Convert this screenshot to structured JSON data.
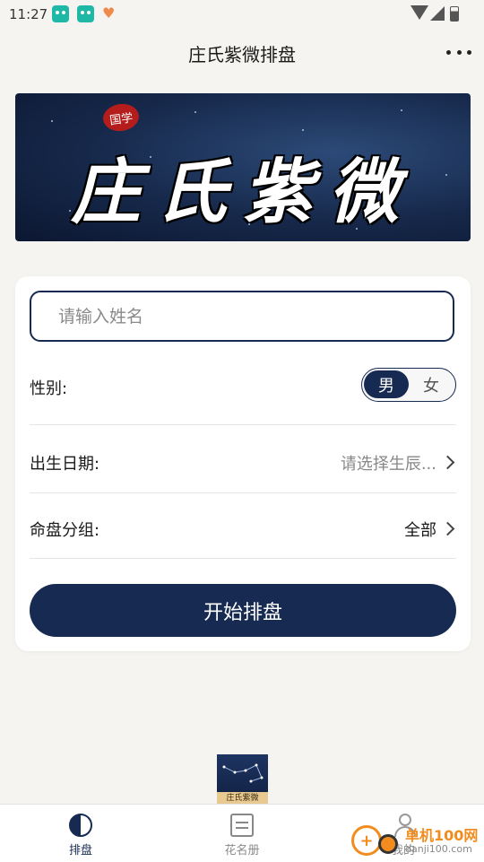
{
  "status": {
    "time": "11:27"
  },
  "header": {
    "title": "庄氏紫微排盘"
  },
  "banner": {
    "seal": "国学",
    "title": "庄氏紫微"
  },
  "form": {
    "name_placeholder": "请输入姓名",
    "gender_label": "性别:",
    "gender_options": [
      "男",
      "女"
    ],
    "gender_selected": "男",
    "birth_label": "出生日期:",
    "birth_value": "请选择生辰...",
    "group_label": "命盘分组:",
    "group_value": "全部",
    "start_label": "开始排盘"
  },
  "thumbnail": {
    "label": "庄氏紫微"
  },
  "tabbar": {
    "items": [
      {
        "label": "排盘",
        "icon": "yinyang-icon",
        "active": true
      },
      {
        "label": "花名册",
        "icon": "document-icon",
        "active": false
      },
      {
        "label": "我的",
        "icon": "user-icon",
        "active": false
      }
    ]
  },
  "watermark": {
    "name": "单机100网",
    "url": "danji100.com"
  },
  "colors": {
    "primary": "#162a52",
    "background": "#f5f4f0",
    "watermark": "#f28c1e"
  }
}
